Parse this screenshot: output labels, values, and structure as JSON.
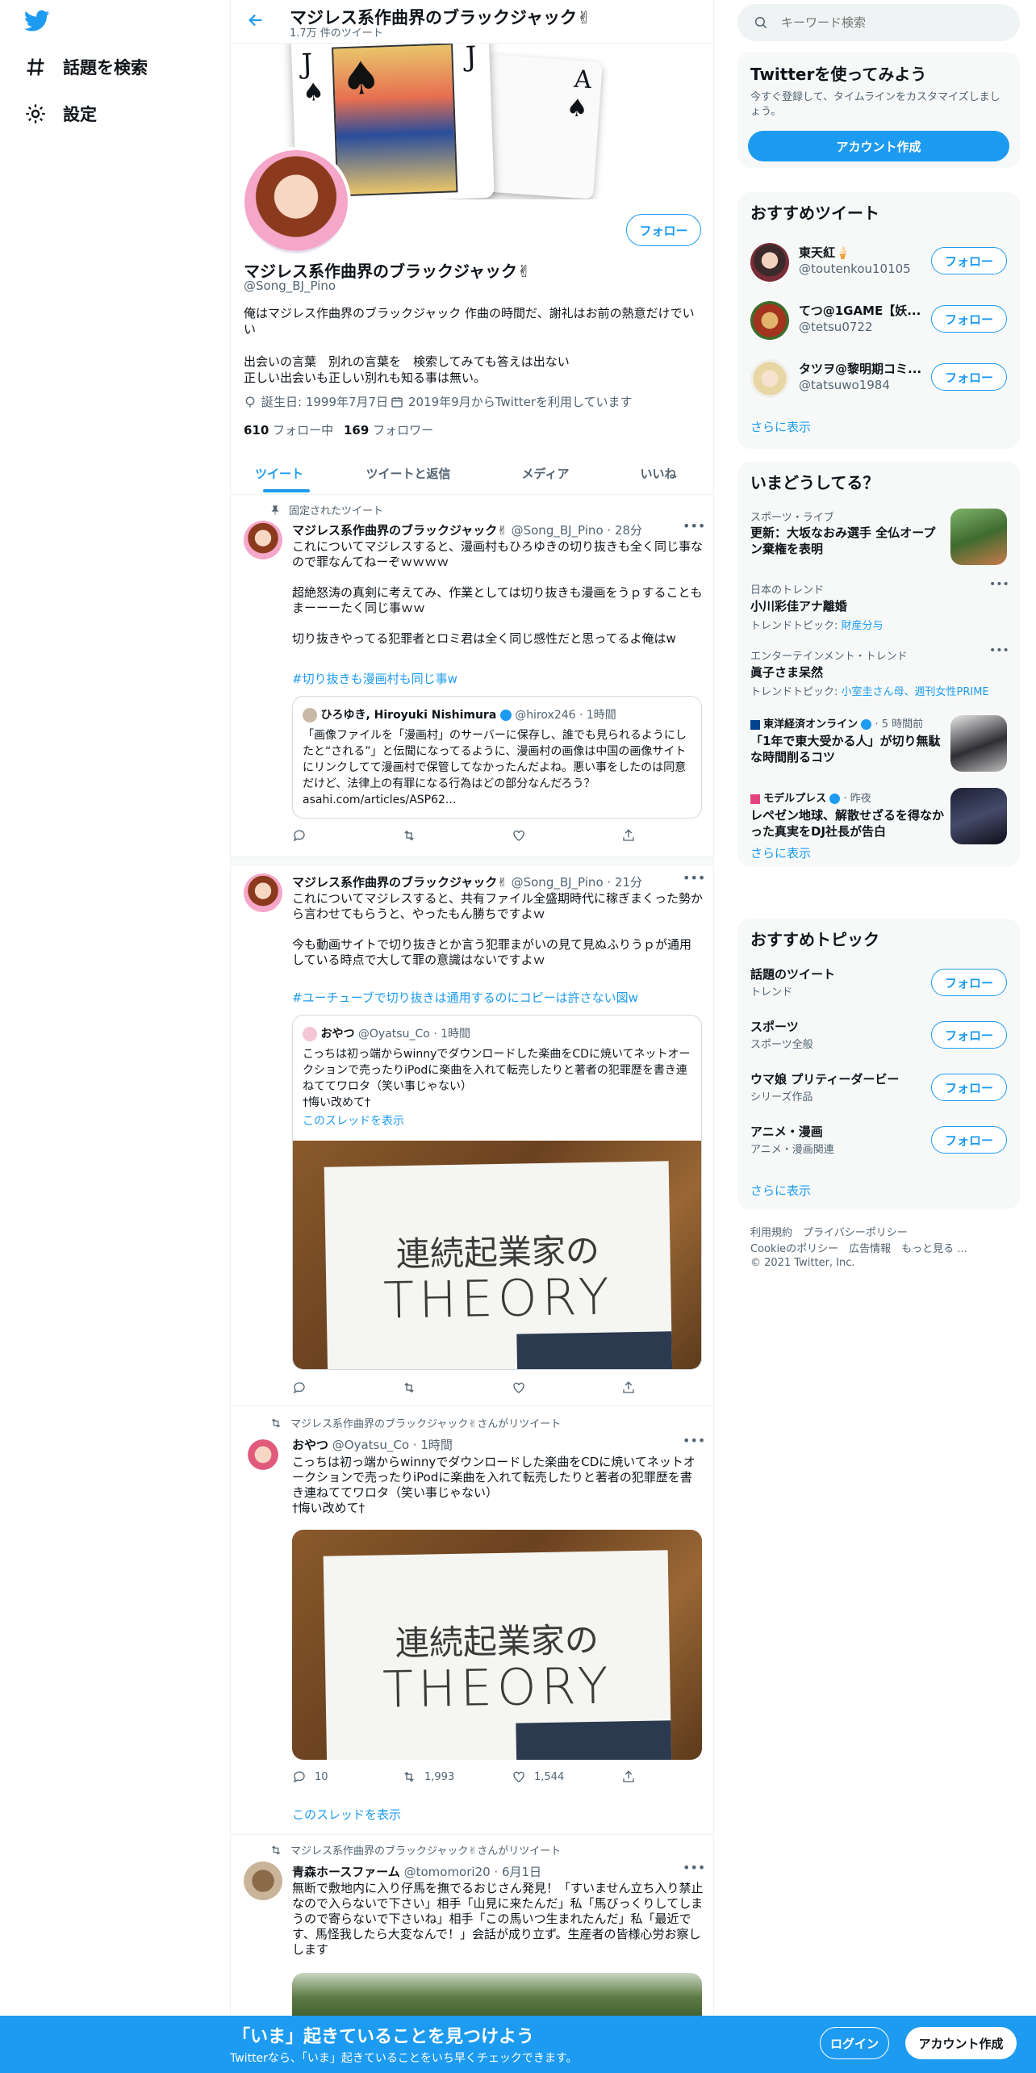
{
  "nav": {
    "explore_label": "話題を検索",
    "settings_label": "設定"
  },
  "header": {
    "title": "マジレス系作曲界のブラックジャック✌",
    "subtitle": "1.7万 件のツイート"
  },
  "profile": {
    "follow_label": "フォロー",
    "name": "マジレス系作曲界のブラックジャック✌",
    "handle": "@Song_BJ_Pino",
    "bio_1": "俺はマジレス作曲界のブラックジャック 作曲の時間だ、謝礼はお前の熱意だけでいい",
    "bio_2": "出会いの言葉　別れの言葉を　検索してみても答えは出ない",
    "bio_3": "正しい出会いも正しい別れも知る事は無い。",
    "birthday": "誕生日: 1999年7月7日",
    "joined": "2019年9月からTwitterを利用しています",
    "following_count": "610",
    "following_label": "フォロー中",
    "followers_count": "169",
    "followers_label": "フォロワー"
  },
  "tabs": [
    "ツイート",
    "ツイートと返信",
    "メディア",
    "いいね"
  ],
  "tweets": {
    "pinned_label": "固定されたツイート",
    "t1": {
      "name": "マジレス系作曲界のブラックジャック✌",
      "meta": "@Song_BJ_Pino · 28分",
      "text": "これについてマジレスすると、漫画村もひろゆきの切り抜きも全く同じ事なので罪なんてねーぞｗｗｗｗ\n\n超絶怒涛の真剣に考えてみ、作業としては切り抜きも漫画をうｐすることもまーーーたく同じ事ｗｗ\n\n切り抜きやってる犯罪者とロミ君は全く同じ感性だと思ってるよ俺はw",
      "hashtag": "#切り抜きも漫画村も同じ事w",
      "quote_name": "ひろゆき, Hiroyuki Nishimura",
      "quote_meta": "@hirox246 · 1時間",
      "quote_text": "「画像ファイルを「漫画村」のサーバーに保存し、誰でも見られるようにしたと“される”」と伝聞になってるように、漫画村の画像は中国の画像サイトにリンクしてて漫画村で保管してなかったんだよね。悪い事をしたのは同意だけど、法律上の有罪になる行為はどの部分なんだろう？ asahi.com/articles/ASP62..."
    },
    "t2": {
      "name": "マジレス系作曲界のブラックジャック✌",
      "meta": "@Song_BJ_Pino · 21分",
      "text": "これについてマジレスすると、共有ファイル全盛期時代に稼ぎまくった勢から言わせてもらうと、やったもん勝ちですよｗ\n\n今も動画サイトで切り抜きとか言う犯罪まがいの見て見ぬふりうｐが通用している時点で大して罪の意識はないですよｗ",
      "hashtag": "#ユーチューブで切り抜きは通用するのにコピーは許さない図w",
      "quote_name": "おやつ",
      "quote_meta": "@Oyatsu_Co · 1時間",
      "quote_text": "こっちは初っ端からwinnyでダウンロードした楽曲をCDに焼いてネットオークションで売ったりiPodに楽曲を入れて転売したりと著者の犯罪歴を書き連ねててワロタ（笑い事じゃない）\n†悔い改めて†",
      "quote_thread": "このスレッドを表示",
      "img_line1": "連続起業家の",
      "img_line2": "THEORY"
    },
    "t3": {
      "retweet_label": "マジレス系作曲界のブラックジャック✌さんがリツイート",
      "name": "おやつ",
      "meta": "@Oyatsu_Co · 1時間",
      "text": "こっちは初っ端からwinnyでダウンロードした楽曲をCDに焼いてネットオークションで売ったりiPodに楽曲を入れて転売したりと著者の犯罪歴を書き連ねててワロタ（笑い事じゃない）\n†悔い改めて†",
      "img_line1": "連続起業家の",
      "img_line2": "THEORY",
      "replies": "10",
      "retweets": "1,993",
      "likes": "1,544",
      "thread_link": "このスレッドを表示"
    },
    "t4": {
      "retweet_label": "マジレス系作曲界のブラックジャック✌さんがリツイート",
      "name": "青森ホースファーム",
      "meta": "@tomomori20 · 6月1日",
      "text": "無断で敷地内に入り仔馬を撫でるおじさん発見！「すいません立ち入り禁止なので入らないで下さい」相手「山見に来たんだ」私「馬びっくりしてしまうので寄らないで下さいね」相手「この馬いつ生まれたんだ」私「最近です、馬怪我したら大変なんで！」会話が成り立ず。生産者の皆様心労お察しします"
    }
  },
  "search": {
    "placeholder": "キーワード検索"
  },
  "signup": {
    "title": "Twitterを使ってみよう",
    "desc": "今すぐ登録して、タイムラインをカスタマイズしましょう。",
    "button": "アカウント作成"
  },
  "recommended_tweets": {
    "title": "おすすめツイート",
    "users": [
      {
        "name": "東天紅🍦",
        "handle": "@toutenkou10105",
        "button": "フォロー"
      },
      {
        "name": "てつ@1GAME【妖...",
        "handle": "@tetsu0722",
        "button": "フォロー"
      },
      {
        "name": "タツヲ@黎明期コミ...",
        "handle": "@tatsuwo1984",
        "button": "フォロー"
      }
    ],
    "more": "さらに表示"
  },
  "trends": {
    "title": "いまどうしてる？",
    "items": [
      {
        "category": "スポーツ・ライブ",
        "title": "更新：大坂なおみ選手 全仏オープン棄権を表明"
      },
      {
        "category": "日本のトレンド",
        "title": "小川彩佳アナ離婚",
        "sub_prefix": "トレンドトピック: ",
        "sub_link": "財産分与"
      },
      {
        "category": "エンターテインメント・トレンド",
        "title": "眞子さま呆然",
        "sub_prefix": "トレンドトピック: ",
        "sub_link": "小室圭さん母、週刊女性PRIME"
      },
      {
        "source": "東洋経済オンライン",
        "time": "· 5 時間前",
        "title": "「1年で東大受かる人」が切り無駄な時間削るコツ"
      },
      {
        "source": "モデルプレス",
        "time": "· 昨夜",
        "title": "レペゼン地球、解散せざるを得なかった真実をDJ社長が告白"
      }
    ],
    "more": "さらに表示"
  },
  "topics": {
    "title": "おすすめトピック",
    "items": [
      {
        "name": "話題のツイート",
        "sub": "トレンド",
        "button": "フォロー"
      },
      {
        "name": "スポーツ",
        "sub": "スポーツ全般",
        "button": "フォロー"
      },
      {
        "name": "ウマ娘 プリティーダービー",
        "sub": "シリーズ作品",
        "button": "フォロー"
      },
      {
        "name": "アニメ・漫画",
        "sub": "アニメ・漫画関連",
        "button": "フォロー"
      }
    ],
    "more": "さらに表示"
  },
  "footer": {
    "line1": "利用規約　プライバシーポリシー",
    "line2": "Cookieのポリシー　広告情報　もっと見る ...",
    "line3": "© 2021 Twitter, Inc."
  },
  "bottombar": {
    "title": "「いま」起きていることを見つけよう",
    "desc": "Twitterなら、「いま」起きていることをいち早くチェックできます。",
    "login": "ログイン",
    "signup": "アカウント作成"
  },
  "colors": {
    "accent": "#1d9bf0",
    "text": "#0f1419",
    "muted": "#536471"
  }
}
